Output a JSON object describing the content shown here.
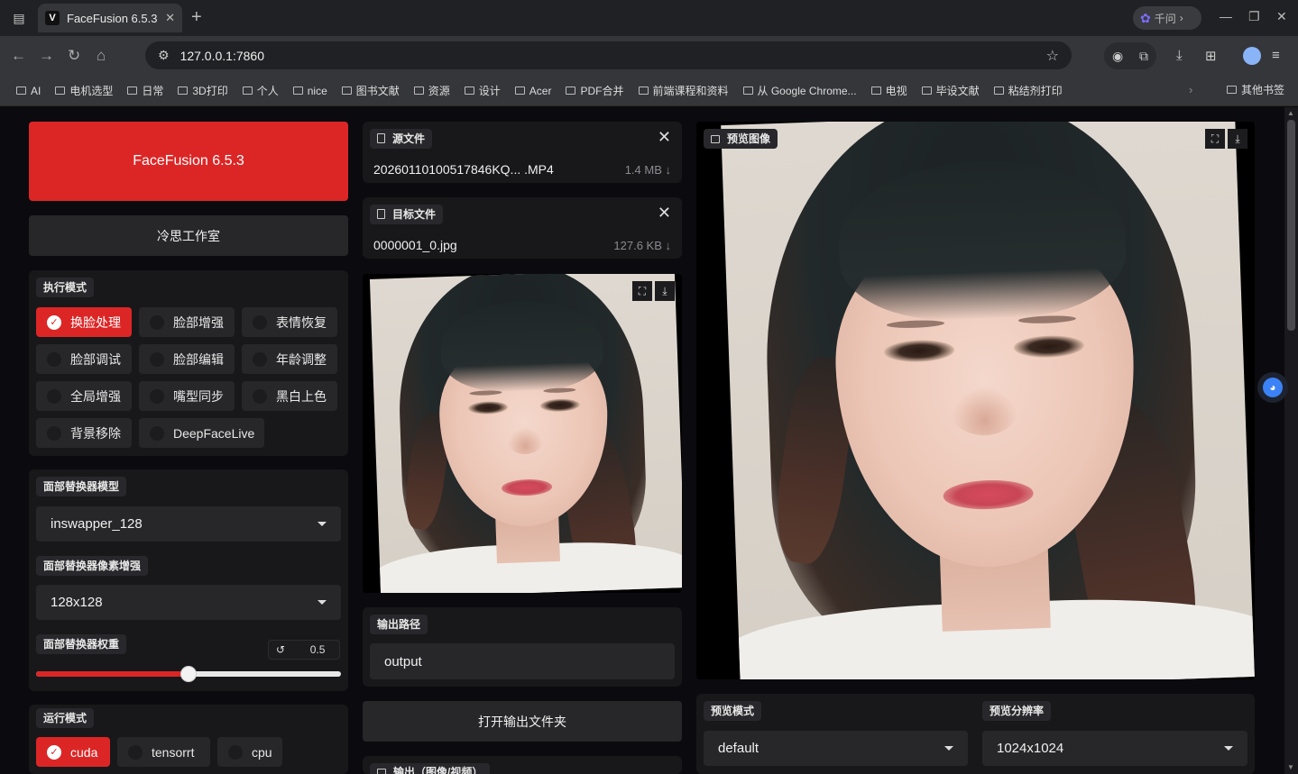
{
  "browser": {
    "tab_title": "FaceFusion 6.5.3",
    "tab_fav": "V",
    "new_tab": "+",
    "qianwen_label": "千问",
    "url": "127.0.0.1:7860",
    "icons": [
      "side-panel-icon",
      "close-icon",
      "plus-icon",
      "minimize-icon",
      "restore-icon",
      "close-window-icon",
      "back-icon",
      "forward-icon",
      "reload-icon",
      "home-icon",
      "tune-icon",
      "star-icon",
      "extension-icon",
      "puzzle-icon",
      "download-icon",
      "bookmark-icon",
      "profile-icon",
      "menu-icon"
    ]
  },
  "bookmarks": {
    "items": [
      "AI",
      "电机选型",
      "日常",
      "3D打印",
      "个人",
      "nice",
      "图书文献",
      "资源",
      "设计",
      "Acer",
      "PDF合并",
      "前端课程和资料",
      "从 Google Chrome...",
      "电视",
      "毕设文献",
      "粘结剂打印"
    ],
    "more": "›",
    "other": "其他书签"
  },
  "left": {
    "header_button": "FaceFusion 6.5.3",
    "studio_button": "冷思工作室",
    "exec_mode_label": "执行模式",
    "exec_modes": [
      {
        "label": "换脸处理",
        "checked": true
      },
      {
        "label": "脸部增强",
        "checked": false
      },
      {
        "label": "表情恢复",
        "checked": false
      },
      {
        "label": "脸部调试",
        "checked": false
      },
      {
        "label": "脸部编辑",
        "checked": false
      },
      {
        "label": "年龄调整",
        "checked": false
      },
      {
        "label": "全局增强",
        "checked": false
      },
      {
        "label": "嘴型同步",
        "checked": false
      },
      {
        "label": "黑白上色",
        "checked": false
      },
      {
        "label": "背景移除",
        "checked": false
      },
      {
        "label": "DeepFaceLive",
        "checked": false
      }
    ],
    "swapper_model_label": "面部替换器模型",
    "swapper_model_value": "inswapper_128",
    "pixel_boost_label": "面部替换器像素增强",
    "pixel_boost_value": "128x128",
    "weight_label": "面部替换器权重",
    "weight_value": "0.5",
    "weight_fraction": 0.5,
    "reset_icon": "↺",
    "run_mode_label": "运行模式",
    "run_modes": [
      {
        "label": "cuda",
        "checked": true
      },
      {
        "label": "tensorrt",
        "checked": false
      },
      {
        "label": "cpu",
        "checked": false
      }
    ],
    "check_mark": "✓"
  },
  "middle": {
    "source_label": "源文件",
    "source_name": "20260110100517846KQ... .MP4",
    "source_size": "1.4 MB ↓",
    "target_label": "目标文件",
    "target_name": "0000001_0.jpg",
    "target_size": "127.6 KB ↓",
    "output_path_label": "输出路径",
    "output_path_value": "output",
    "open_folder_button": "打开输出文件夹",
    "output_label": "输出（图像/视频）",
    "close_glyph": "✕",
    "fullscreen_glyph": "⛶",
    "download_glyph": "⤓"
  },
  "right": {
    "preview_label": "预览图像",
    "preview_mode_label": "预览模式",
    "preview_mode_value": "default",
    "preview_res_label": "预览分辨率",
    "preview_res_value": "1024x1024"
  }
}
